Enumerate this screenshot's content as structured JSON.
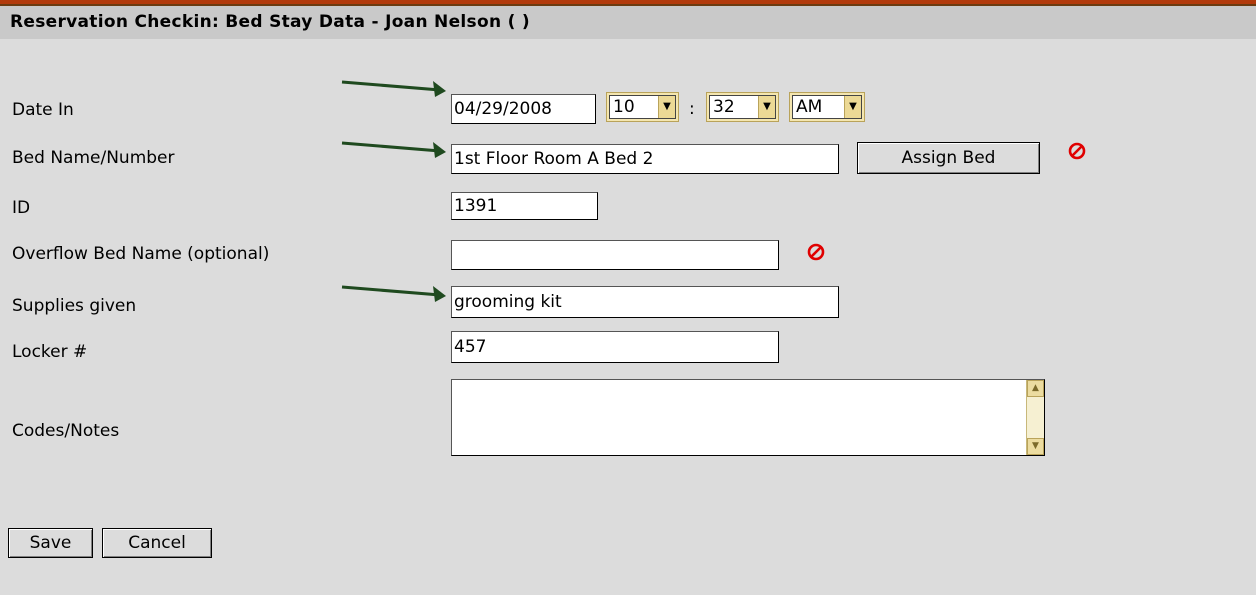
{
  "header": {
    "title": "Reservation Checkin: Bed Stay Data - Joan Nelson ( )"
  },
  "form": {
    "date_in": {
      "label": "Date In",
      "date_value": "04/29/2008",
      "hour": "10",
      "separator": ":",
      "minute": "32",
      "ampm": "AM"
    },
    "bed_name": {
      "label": "Bed Name/Number",
      "value": "1st Floor Room A Bed 2",
      "assign_button": "Assign Bed"
    },
    "id": {
      "label": "ID",
      "value": "1391"
    },
    "overflow_bed": {
      "label": "Overflow Bed Name (optional)",
      "value": ""
    },
    "supplies": {
      "label": "Supplies given",
      "value": "grooming kit"
    },
    "locker": {
      "label": "Locker #",
      "value": "457"
    },
    "codes_notes": {
      "label": "Codes/Notes",
      "value": ""
    }
  },
  "buttons": {
    "save": "Save",
    "cancel": "Cancel"
  },
  "icons": {
    "clear_icon": "no-symbol-icon",
    "pointer_arrow": "right-arrow-icon"
  },
  "colors": {
    "accent_red": "#e00000",
    "arrow_green": "#1f4a1f",
    "header_rule": "#b23a0b"
  }
}
